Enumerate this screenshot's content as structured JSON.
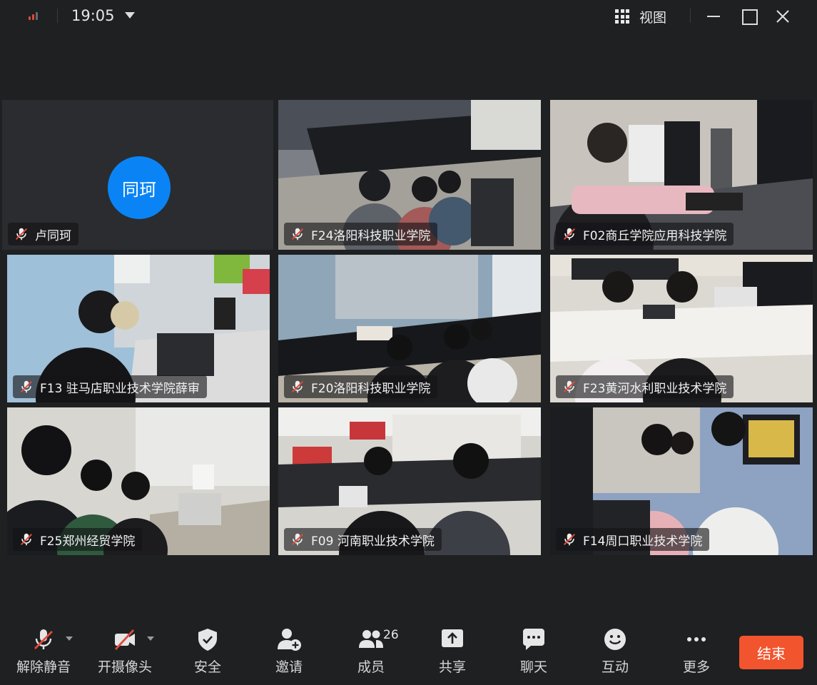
{
  "topbar": {
    "time": "19:05",
    "view_label": "视图"
  },
  "tiles": [
    {
      "type": "avatar",
      "avatar_text": "同珂",
      "label": "卢同珂"
    },
    {
      "type": "video",
      "label": "F24洛阳科技职业学院"
    },
    {
      "type": "video",
      "label": "F02商丘学院应用科技学院"
    },
    {
      "type": "video",
      "label": "F13 驻马店职业技术学院薛审"
    },
    {
      "type": "video",
      "label": "F20洛阳科技职业学院"
    },
    {
      "type": "video",
      "label": "F23黄河水利职业技术学院"
    },
    {
      "type": "video",
      "label": "F25郑州经贸学院"
    },
    {
      "type": "video",
      "label": "F09 河南职业技术学院"
    },
    {
      "type": "video",
      "label": "F14周口职业技术学院"
    }
  ],
  "toolbar": {
    "unmute": "解除静音",
    "camera": "开摄像头",
    "security": "安全",
    "invite": "邀请",
    "members": "成员",
    "members_count": "26",
    "share": "共享",
    "chat": "聊天",
    "interact": "互动",
    "more": "更多",
    "end": "结束"
  },
  "colors": {
    "background": "#1f2022",
    "avatar": "#0a84f5",
    "end_button": "#f2542d",
    "mute_slash": "#e04a3a"
  }
}
